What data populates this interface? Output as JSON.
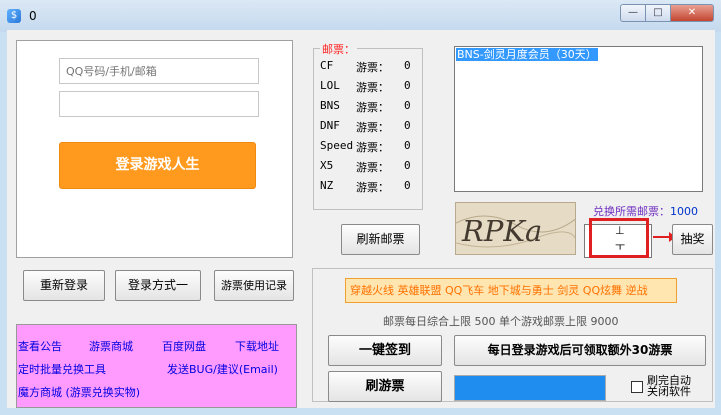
{
  "window": {
    "title": "0",
    "close_glyph": "✕",
    "min_glyph": "—",
    "max_glyph": "□"
  },
  "login": {
    "account_placeholder": "QQ号码/手机/邮箱",
    "password_placeholder": "",
    "login_label": "登录游戏人生"
  },
  "buttons": {
    "relogin": "重新登录",
    "login_mode": "登录方式一",
    "ticket_record": "游票使用记录",
    "refresh_mail": "刷新邮票",
    "draw": "抽奖",
    "sign_in": "一键签到",
    "daily_bonus": "每日登录游戏后可领取额外30游票",
    "refresh_ticket": "刷游票"
  },
  "mail_group": {
    "legend": "邮票：",
    "ticket_label": "游票：",
    "rows": [
      {
        "game": "CF",
        "count": "0"
      },
      {
        "game": "LOL",
        "count": "0"
      },
      {
        "game": "BNS",
        "count": "0"
      },
      {
        "game": "DNF",
        "count": "0"
      },
      {
        "game": "Speed",
        "count": "0"
      },
      {
        "game": "X5",
        "count": "0"
      },
      {
        "game": "NZ",
        "count": "0"
      }
    ]
  },
  "prize_list": {
    "selected_item": "BNS-剑灵月度会员（30天）"
  },
  "captcha": {
    "text": "RPKa",
    "input_value": "⊥\nㅜ"
  },
  "exchange": {
    "label": "兑换所需邮票：",
    "value": "1000"
  },
  "links": {
    "announcement": "查看公告",
    "shop": "游票商城",
    "netdisk": "百度网盘",
    "download": "下载地址",
    "batch_tool": "定时批量兑换工具",
    "feedback": "发送BUG/建议(Email)",
    "magic_shop": "魔方商城 (游票兑换实物)"
  },
  "games_bar": {
    "text": "穿越火线 英雄联盟 QQ飞车 地下城与勇士 剑灵 QQ炫舞 逆战"
  },
  "limit_text": "邮票每日综合上限 500 单个游戏邮票上限 9000",
  "progress": {
    "percent": 100
  },
  "auto_close": {
    "label_line1": "刷完自动",
    "label_line2": "关闭软件",
    "checked": false
  },
  "colors": {
    "accent_orange": "#ff9a1e",
    "highlight_red": "#e02020",
    "pink_panel": "#ff9aff",
    "progress_blue": "#1f8cf0"
  }
}
